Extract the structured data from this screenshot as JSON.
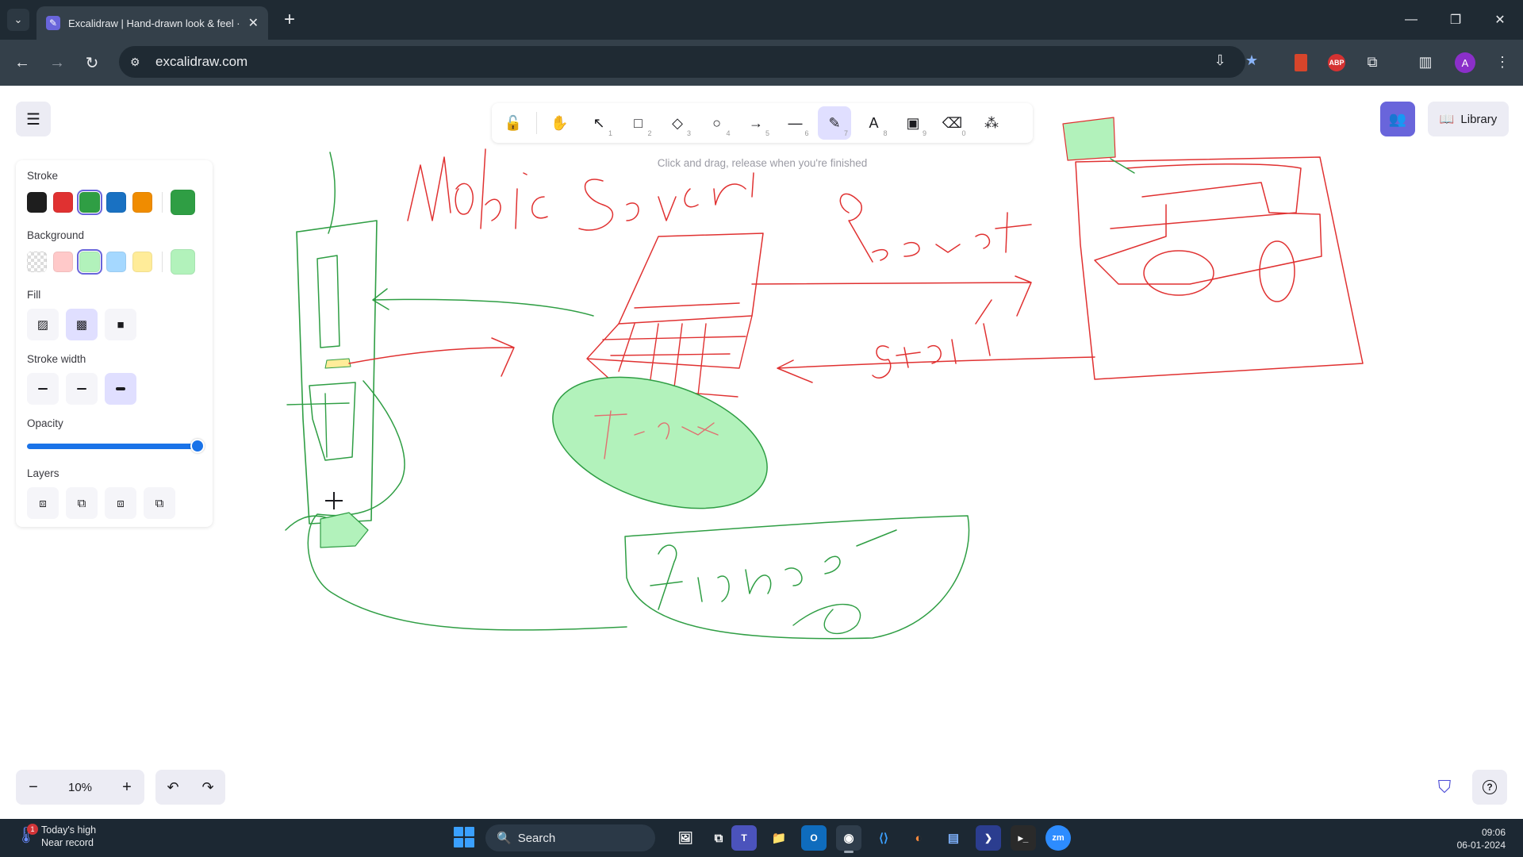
{
  "browser": {
    "tab_title": "Excalidraw | Hand-drawn look & feel ·",
    "url": "excalidraw.com",
    "extensions": {
      "abp": "ABP"
    },
    "profile_initial": "A"
  },
  "toolbar": {
    "tools": [
      {
        "name": "lock",
        "icon": "lock-icon",
        "glyph": "🔓",
        "key": ""
      },
      {
        "name": "hand",
        "icon": "hand-icon",
        "glyph": "✋",
        "key": ""
      },
      {
        "name": "selection",
        "icon": "pointer-icon",
        "glyph": "↖",
        "key": "1"
      },
      {
        "name": "rectangle",
        "icon": "rectangle-icon",
        "glyph": "□",
        "key": "2"
      },
      {
        "name": "diamond",
        "icon": "diamond-icon",
        "glyph": "◇",
        "key": "3"
      },
      {
        "name": "ellipse",
        "icon": "ellipse-icon",
        "glyph": "○",
        "key": "4"
      },
      {
        "name": "arrow",
        "icon": "arrow-icon",
        "glyph": "→",
        "key": "5"
      },
      {
        "name": "line",
        "icon": "line-icon",
        "glyph": "—",
        "key": "6"
      },
      {
        "name": "draw",
        "icon": "pencil-icon",
        "glyph": "✎",
        "key": "7"
      },
      {
        "name": "text",
        "icon": "text-icon",
        "glyph": "A",
        "key": "8"
      },
      {
        "name": "image",
        "icon": "image-icon",
        "glyph": "▣",
        "key": "9"
      },
      {
        "name": "eraser",
        "icon": "eraser-icon",
        "glyph": "⌫",
        "key": "0"
      },
      {
        "name": "extra-tools",
        "icon": "shapes-icon",
        "glyph": "⁂",
        "key": ""
      }
    ],
    "active_tool": "draw",
    "hint": "Click and drag, release when you're finished"
  },
  "header_right": {
    "library_label": "Library"
  },
  "properties": {
    "stroke_title": "Stroke",
    "stroke_colors": [
      "#1e1e1e",
      "#e03131",
      "#2f9e44",
      "#1971c2",
      "#f08c00"
    ],
    "stroke_selected": "#2f9e44",
    "stroke_current": "#2f9e44",
    "background_title": "Background",
    "background_colors": [
      "transparent",
      "#ffc9c9",
      "#b2f2bb",
      "#a5d8ff",
      "#ffec99"
    ],
    "background_selected": "#b2f2bb",
    "background_current": "#b2f2bb",
    "fill_title": "Fill",
    "fill_options": [
      {
        "name": "hachure",
        "glyph": "▨"
      },
      {
        "name": "cross-hatch",
        "glyph": "▩"
      },
      {
        "name": "solid",
        "glyph": "■"
      }
    ],
    "fill_selected": "cross-hatch",
    "stroke_width_title": "Stroke width",
    "stroke_width_options": [
      "thin",
      "bold",
      "extra-bold"
    ],
    "stroke_width_selected": "extra-bold",
    "opacity_title": "Opacity",
    "opacity_value": 100,
    "layers_title": "Layers",
    "layer_options": [
      "send-to-back",
      "send-backward",
      "bring-forward",
      "bring-to-front"
    ]
  },
  "footer": {
    "zoom_value": "10%"
  },
  "canvas_text": {
    "labels": [
      "Mobile",
      "Server",
      "Remote",
      "Start",
      "Firebase",
      "Frame"
    ]
  },
  "colors": {
    "accent": "#6965db",
    "stroke_red": "#e03131",
    "stroke_green": "#2f9e44",
    "fill_green": "#b2f2bb",
    "fill_yellow": "#ffec99"
  },
  "taskbar": {
    "weather_line1": "Today's high",
    "weather_line2": "Near record",
    "weather_badge": "1",
    "search_placeholder": "Search",
    "time": "09:06",
    "date": "06-01-2024"
  }
}
